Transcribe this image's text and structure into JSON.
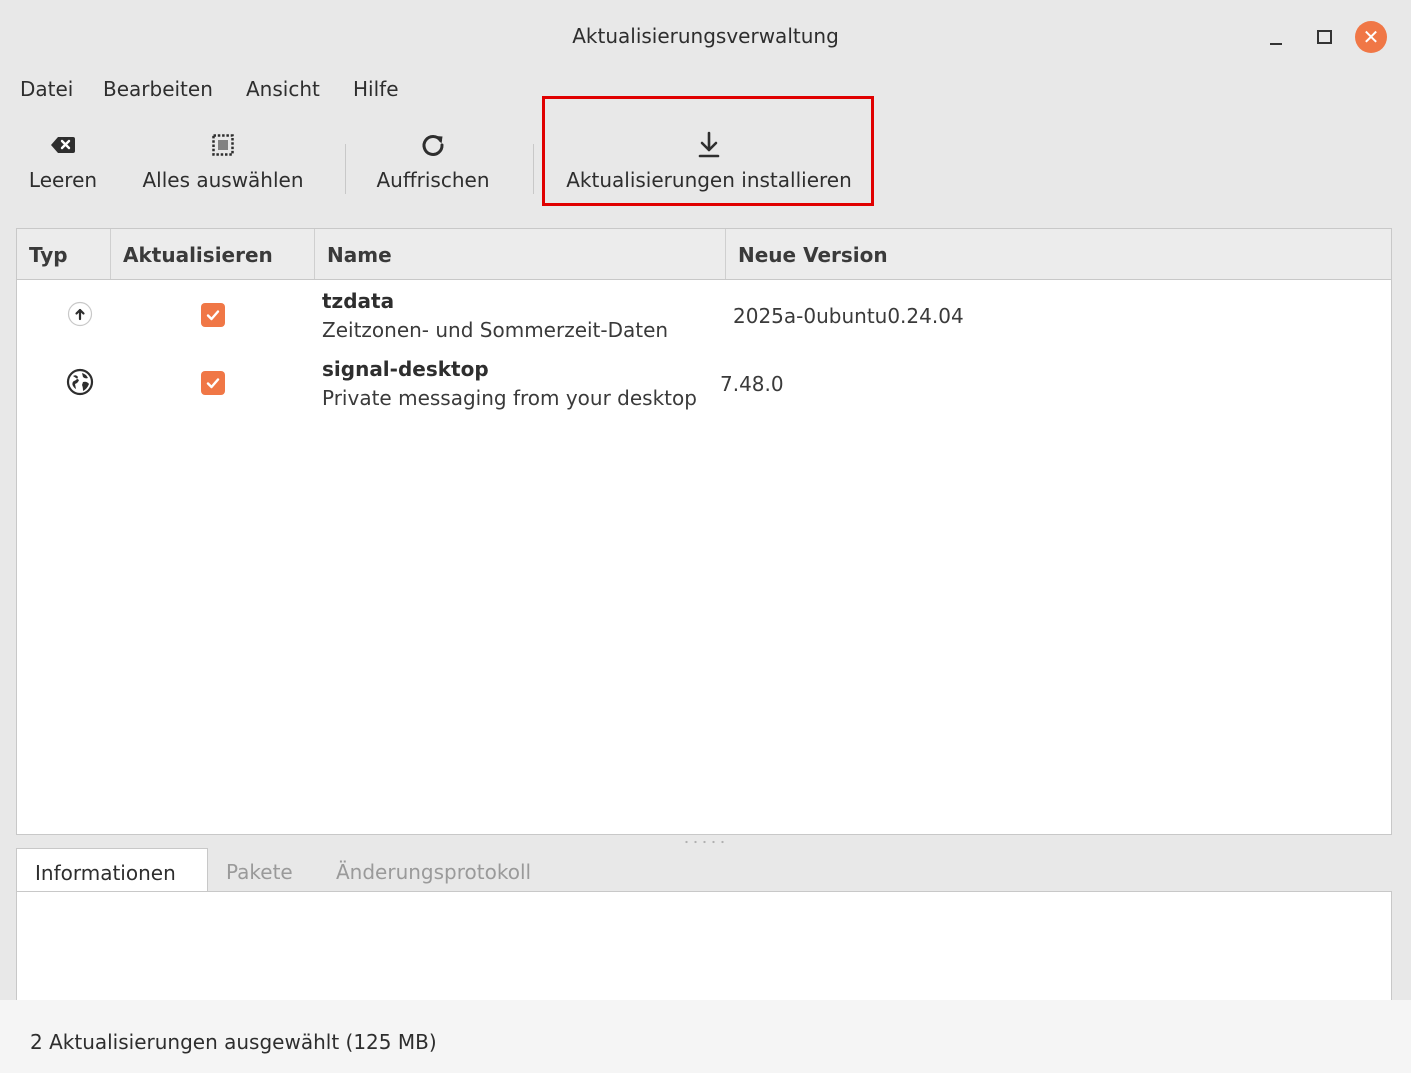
{
  "window": {
    "title": "Aktualisierungsverwaltung"
  },
  "menu": {
    "items": [
      "Datei",
      "Bearbeiten",
      "Ansicht",
      "Hilfe"
    ]
  },
  "toolbar": {
    "clear_label": "Leeren",
    "select_all_label": "Alles auswählen",
    "refresh_label": "Auffrischen",
    "install_label": "Aktualisierungen installieren"
  },
  "table": {
    "columns": [
      "Typ",
      "Aktualisieren",
      "Name",
      "Neue Version"
    ],
    "rows": [
      {
        "type_icon": "upgrade-icon",
        "checked": true,
        "name": "tzdata",
        "description": "Zeitzonen- und Sommerzeit-Daten",
        "new_version": "2025a-0ubuntu0.24.04"
      },
      {
        "type_icon": "globe-icon",
        "checked": true,
        "name": "signal-desktop",
        "description": "Private messaging from your desktop",
        "new_version": "7.48.0"
      }
    ]
  },
  "tabs": [
    "Informationen",
    "Pakete",
    "Änderungsprotokoll"
  ],
  "status": {
    "text": "2 Aktualisierungen ausgewählt (125 MB)"
  },
  "colors": {
    "accent": "#f07746",
    "highlight": "#e00000"
  }
}
